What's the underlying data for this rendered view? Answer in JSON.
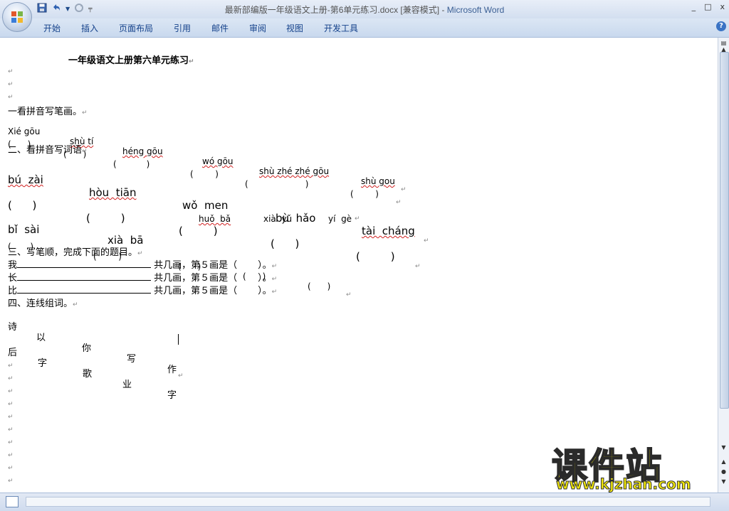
{
  "window": {
    "title_doc": "最新部编版一年级语文上册-第6单元练习.docx [兼容模式] - ",
    "title_app": "Microsoft Word",
    "controls": [
      "_",
      "□",
      "x"
    ]
  },
  "qat": [
    "save",
    "undo",
    "redo"
  ],
  "ribbon_tabs": [
    "开始",
    "插入",
    "页面布局",
    "引用",
    "邮件",
    "审阅",
    "视图",
    "开发工具"
  ],
  "help_label": "?",
  "doc": {
    "title": "一年级语文上册第六单元练习",
    "s1_heading": "一看拼音写笔画。",
    "s1_pinyin": [
      "Xié gōu",
      "shù tí",
      "héng gōu",
      "wó gōu",
      "shù zhé zhé gōu",
      "shù gou"
    ],
    "s1_brackets": [
      "(      )",
      "(      )",
      "(           )",
      "(        )",
      "(                     )",
      "(        )"
    ],
    "s2_heading": "二、看拼音写词语",
    "s2_row1": [
      "bú  zài",
      "hòu  tiān",
      "wǒ  men",
      "bù  hǎo",
      "tài  cháng"
    ],
    "s2_brackets1": [
      "(      )",
      "(         )",
      "(         )",
      "(      )",
      "(         )"
    ],
    "s2_row2": [
      "bǐ  sài",
      "xià  bā",
      "huǒ  bǎ",
      "xià  yǔ",
      "yí  gè"
    ],
    "s2_brackets2": [
      "(       )",
      "(        )",
      "(      )",
      "(      )",
      "(      )"
    ],
    "s3_heading": "三、写笔顺，完成下面的题目。",
    "s3_rows": [
      {
        "char": "我",
        "tail": "共几画，第５画是（       ）。"
      },
      {
        "char": "长",
        "tail": "共几画，第５画是（       ）。"
      },
      {
        "char": "比",
        "tail": "共几画，第５画是（       ）。"
      }
    ],
    "s4_heading": "四、连线组词。",
    "s4_row1": [
      "诗",
      "以",
      "你",
      "写",
      "作"
    ],
    "s4_row2": [
      "后",
      "字",
      "歌",
      "业",
      "字"
    ]
  },
  "watermark": {
    "main": "课件站",
    "url": "www.kjzhan.com"
  },
  "colors": {
    "ribbon": "#c9d9ee",
    "tab_text": "#15428b",
    "watermark": "#f0e60a"
  }
}
